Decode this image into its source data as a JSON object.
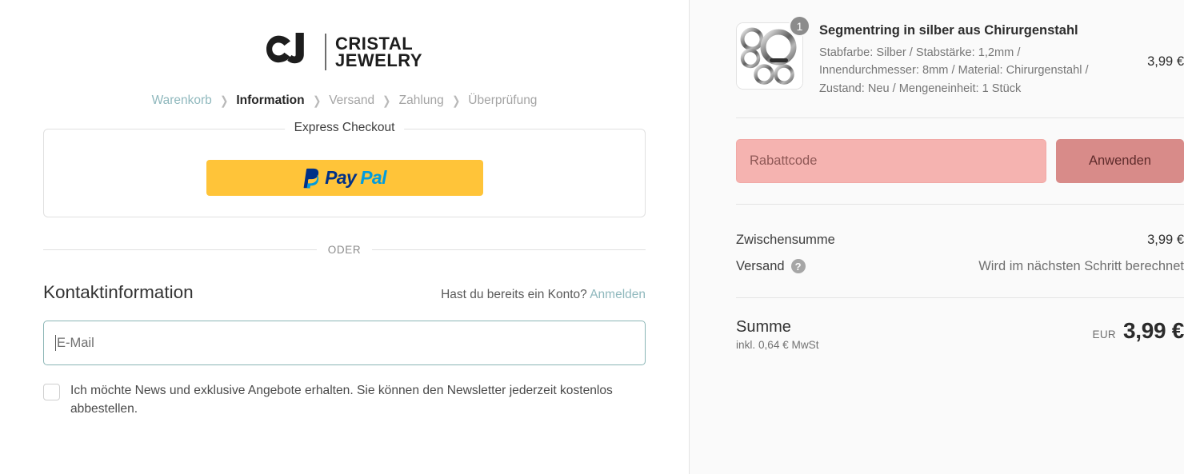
{
  "brand": {
    "monogram": "CJ",
    "name_line1": "CRISTAL",
    "name_line2": "JEWELRY"
  },
  "breadcrumb": {
    "items": [
      {
        "label": "Warenkorb",
        "state": "link"
      },
      {
        "label": "Information",
        "state": "current"
      },
      {
        "label": "Versand",
        "state": "muted"
      },
      {
        "label": "Zahlung",
        "state": "muted"
      },
      {
        "label": "Überprüfung",
        "state": "muted"
      }
    ],
    "separator": "❯"
  },
  "express": {
    "legend": "Express Checkout",
    "paypal": {
      "pay": "Pay",
      "pal": "Pal",
      "icon": "paypal-icon"
    }
  },
  "divider": {
    "or_label": "ODER"
  },
  "contact": {
    "title": "Kontaktinformation",
    "account_prompt": "Hast du bereits ein Konto?",
    "login_label": "Anmelden",
    "email_placeholder": "E-Mail",
    "email_value": "",
    "newsletter_label": "Ich möchte News und exklusive Angebote erhalten. Sie können den Newsletter jederzeit kostenlos abbestellen.",
    "newsletter_checked": false
  },
  "summary": {
    "line_item": {
      "image_alt": "segment-rings-silver",
      "quantity": "1",
      "title": "Segmentring in silber aus Chirurgenstahl",
      "variant": "Stabfarbe: Silber / Stabstärke: 1,2mm / Innendurchmesser: 8mm / Material: Chirurgenstahl / Zustand: Neu / Mengeneinheit: 1 Stück",
      "price": "3,99 €"
    },
    "discount": {
      "placeholder": "Rabattcode",
      "value": "",
      "apply_label": "Anwenden"
    },
    "subtotal_label": "Zwischensumme",
    "subtotal_value": "3,99 €",
    "shipping_label": "Versand",
    "shipping_help_icon": "help-icon",
    "shipping_value": "Wird im nächsten Schritt berechnet",
    "total_label": "Summe",
    "total_tax_note": "inkl. 0,64 € MwSt",
    "total_currency": "EUR",
    "total_amount": "3,99 €"
  },
  "colors": {
    "link": "#8fb8bd",
    "paypal_button": "#ffc439",
    "paypal_dark": "#003087",
    "paypal_light": "#009cde",
    "discount_field": "#f5b3b0",
    "apply_button": "#d88b89",
    "summary_bg": "#fafafa",
    "input_focus_border": "#8ab5b5"
  }
}
